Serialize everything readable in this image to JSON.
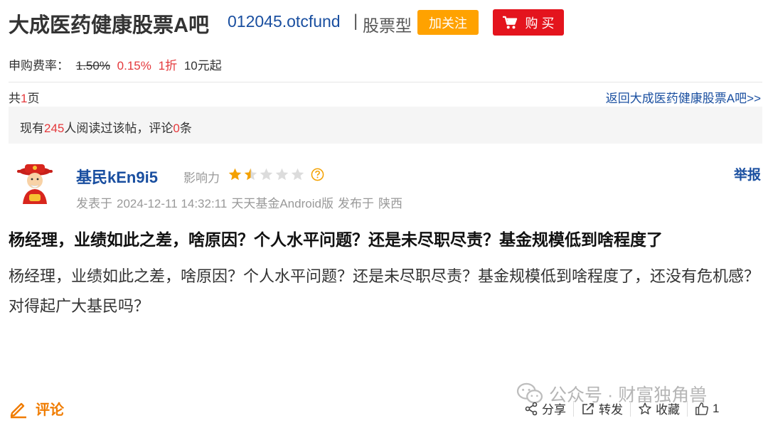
{
  "header": {
    "bar_name": "大成医药健康股票A吧",
    "fund_code": "012045.otcfund",
    "separator": "|",
    "fund_type": "股票型",
    "follow_label": "加关注",
    "buy_label": "购 买"
  },
  "fees": {
    "label": "申购费率：",
    "old_rate": "1.50%",
    "new_rate": "0.15%",
    "discount": "1折",
    "min_amount": "10元起"
  },
  "pagination": {
    "prefix": "共",
    "count": "1",
    "suffix": "页",
    "back_link": "返回大成医药健康股票A吧>>"
  },
  "stats": {
    "prefix": "现有",
    "reads": "245",
    "middle": "人阅读过该帖，评论",
    "comments": "0",
    "suffix": "条"
  },
  "post": {
    "username": "基民kEn9i5",
    "influence_label": "影响力",
    "influence_stars": 1.5,
    "influence_max": 5,
    "report_label": "举报",
    "posted_at_label": "发表于",
    "posted_at": "2024-12-11 14:32:11",
    "client": "天天基金Android版",
    "location_label": "发布于",
    "location": "陕西",
    "title": "杨经理，业绩如此之差，啥原因？个人水平问题？还是未尽职尽责？基金规模低到啥程度了",
    "body": "杨经理，业绩如此之差，啥原因？个人水平问题？还是未尽职尽责？基金规模低到啥程度了，还没有危机感？对得起广大基民吗？"
  },
  "footer": {
    "comment_label": "评论",
    "watermark": "公众号 · 财富独角兽",
    "share_label": "分享",
    "repost_label": "转发",
    "favorite_label": "收藏",
    "like_count": "1"
  },
  "colors": {
    "link_blue": "#1a4fa0",
    "accent_red": "#e4393c",
    "follow_orange": "#ffa200",
    "buy_red": "#e4141d",
    "comment_orange": "#f07c00"
  }
}
